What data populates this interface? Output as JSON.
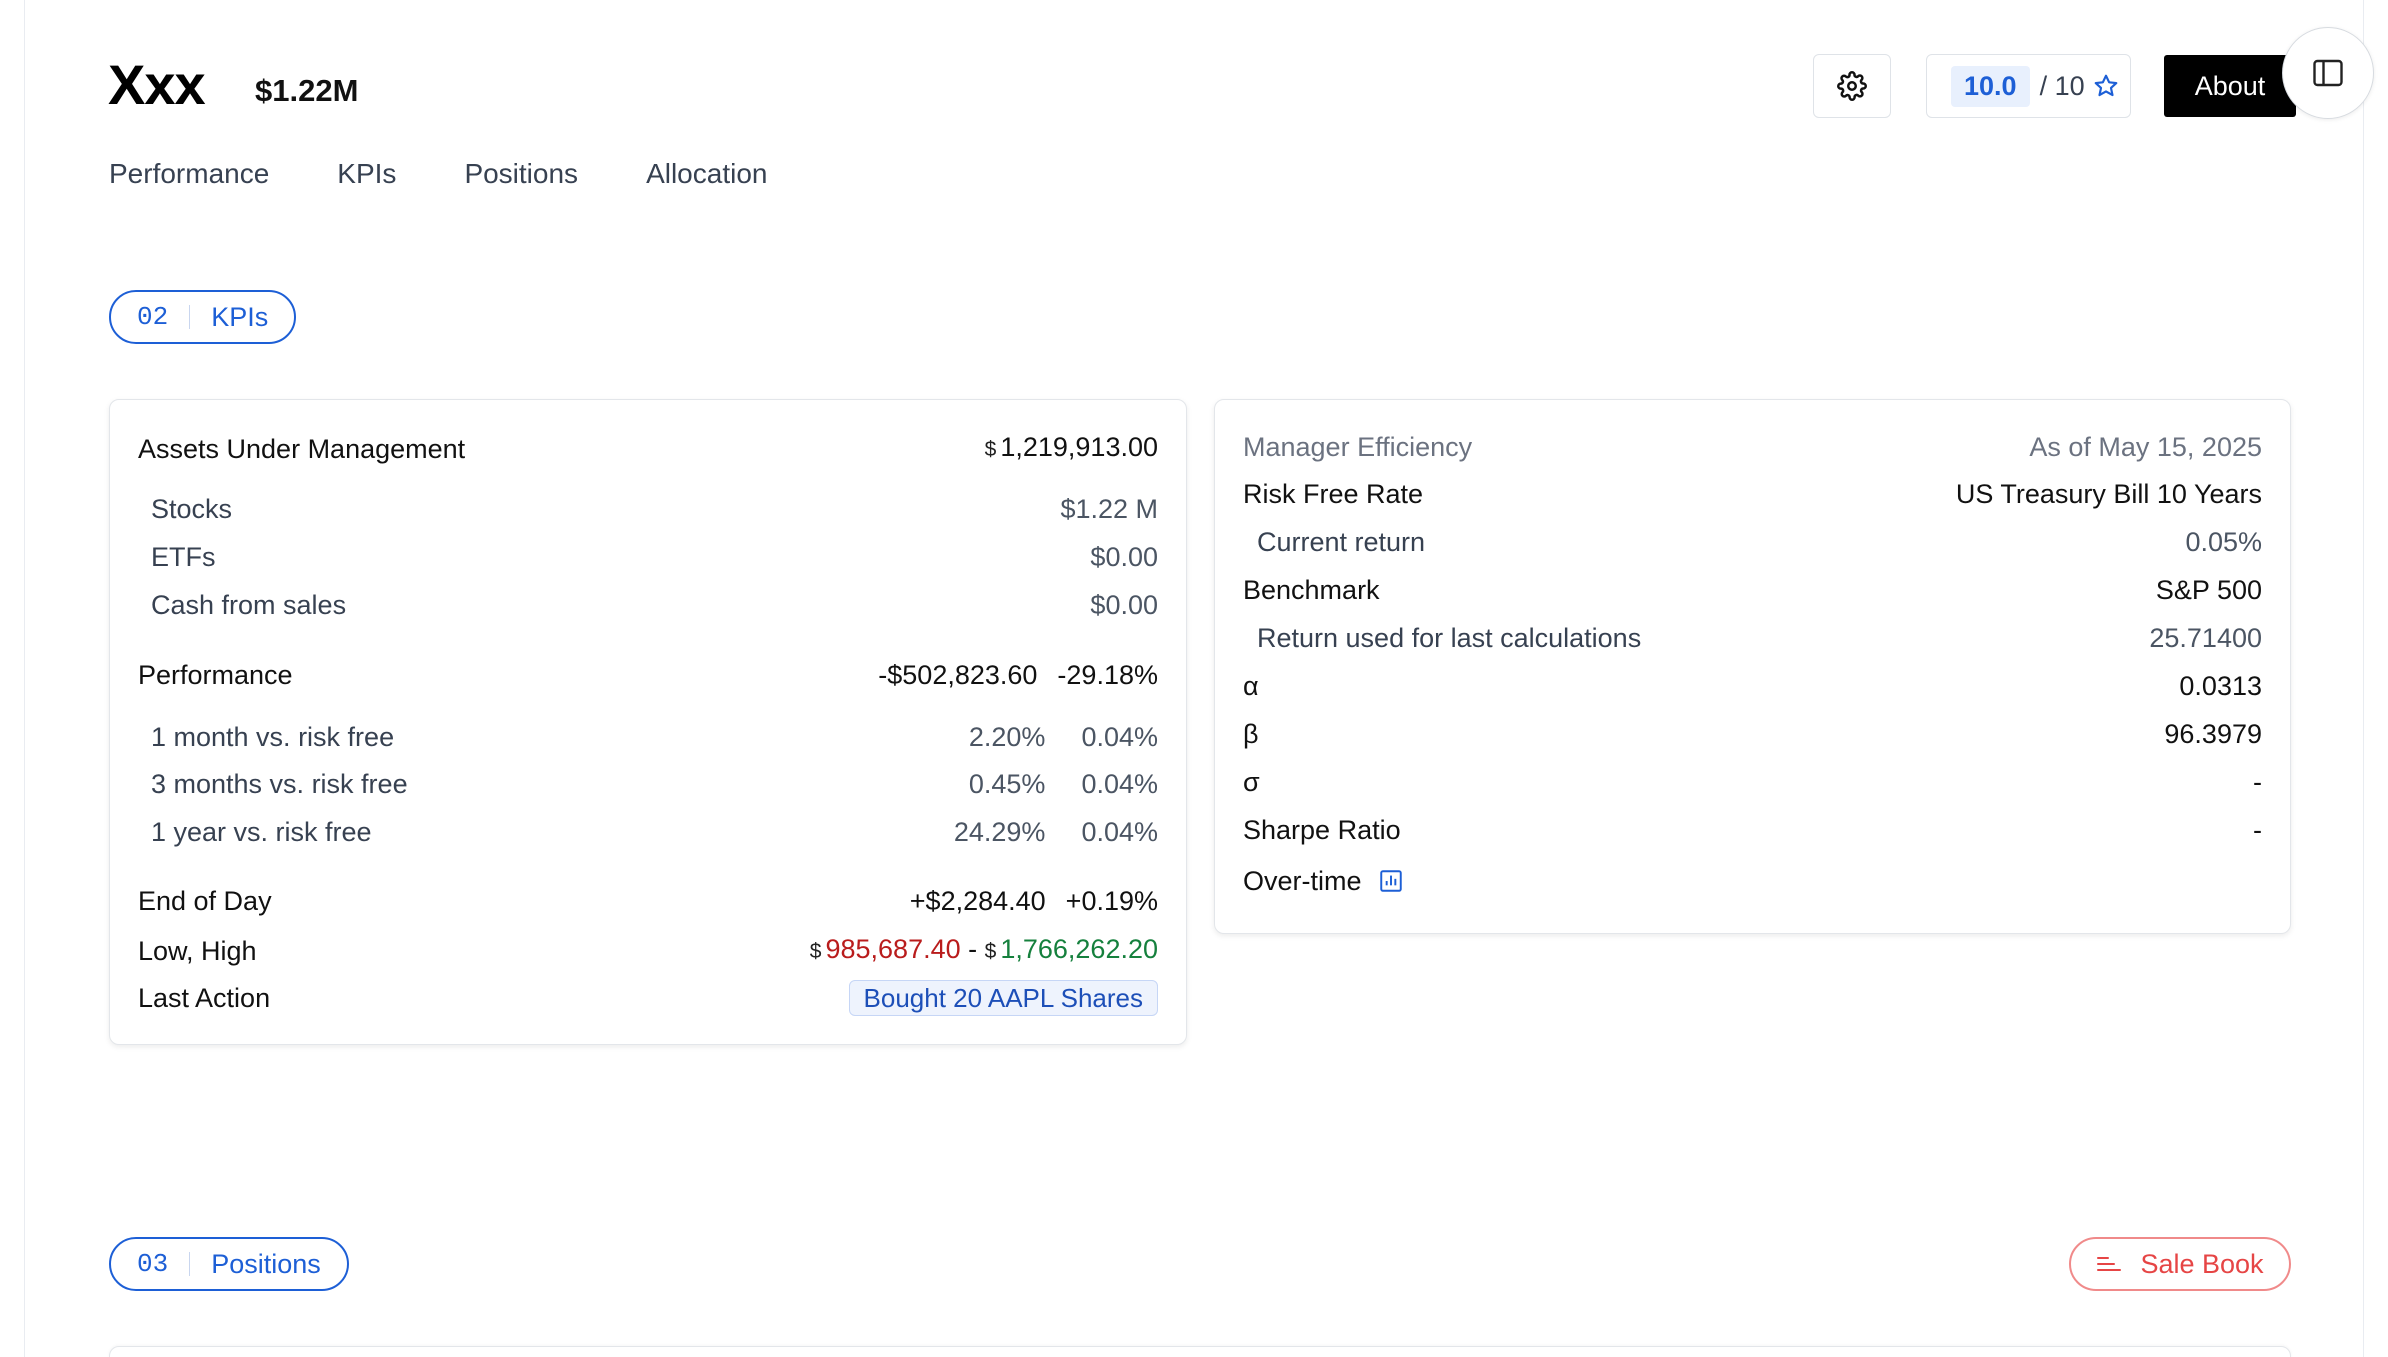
{
  "header": {
    "brand": "Xxx",
    "aum_short": "$1.22M",
    "rating": {
      "value": "10.0",
      "max": "/ 10"
    },
    "about_label": "About",
    "icons": {
      "settings": "gear-icon",
      "rating": "star-icon",
      "sidebar": "sidebar-toggle-icon"
    }
  },
  "tabs": [
    {
      "label": "Performance"
    },
    {
      "label": "KPIs"
    },
    {
      "label": "Positions"
    },
    {
      "label": "Allocation"
    }
  ],
  "sections": {
    "kpis": {
      "num": "02",
      "label": "KPIs"
    },
    "positions": {
      "num": "03",
      "label": "Positions"
    },
    "sale_book_label": "Sale Book"
  },
  "aum_card": {
    "title": "Assets Under Management",
    "currency_symbol": "$",
    "total": "1,219,913.00",
    "breakdown": [
      {
        "label": "Stocks",
        "value": "$1.22 M"
      },
      {
        "label": "ETFs",
        "value": "$0.00"
      },
      {
        "label": "Cash from sales",
        "value": "$0.00"
      }
    ],
    "performance": {
      "label": "Performance",
      "amount": "-$502,823.60",
      "percent": "-29.18%"
    },
    "vs_risk_free": [
      {
        "label": "1 month vs. risk free",
        "ret": "2.20%",
        "rf": "0.04%"
      },
      {
        "label": "3 months vs. risk free",
        "ret": "0.45%",
        "rf": "0.04%"
      },
      {
        "label": "1 year vs. risk free",
        "ret": "24.29%",
        "rf": "0.04%"
      }
    ],
    "end_of_day": {
      "label": "End of Day",
      "amount": "+$2,284.40",
      "percent": "+0.19%"
    },
    "low_high": {
      "label": "Low, High",
      "low": "985,687.40",
      "sep": "-",
      "high": "1,766,262.20"
    },
    "last_action": {
      "label": "Last Action",
      "value": "Bought 20 AAPL Shares"
    }
  },
  "efficiency_card": {
    "title": "Manager Efficiency",
    "as_of": "As of May 15, 2025",
    "risk_free": {
      "label": "Risk Free Rate",
      "value": "US Treasury Bill 10 Years"
    },
    "current_return": {
      "label": "Current return",
      "value": "0.05%"
    },
    "benchmark": {
      "label": "Benchmark",
      "value": "S&P 500"
    },
    "benchmark_return": {
      "label": "Return used for last calculations",
      "value": "25.71400"
    },
    "alpha": {
      "label": "α",
      "value": "0.0313"
    },
    "beta": {
      "label": "β",
      "value": "96.3979"
    },
    "sigma": {
      "label": "σ",
      "value": "-"
    },
    "sharpe": {
      "label": "Sharpe Ratio",
      "value": "-"
    },
    "over_time": {
      "label": "Over-time",
      "icon": "bar-chart-icon"
    }
  }
}
